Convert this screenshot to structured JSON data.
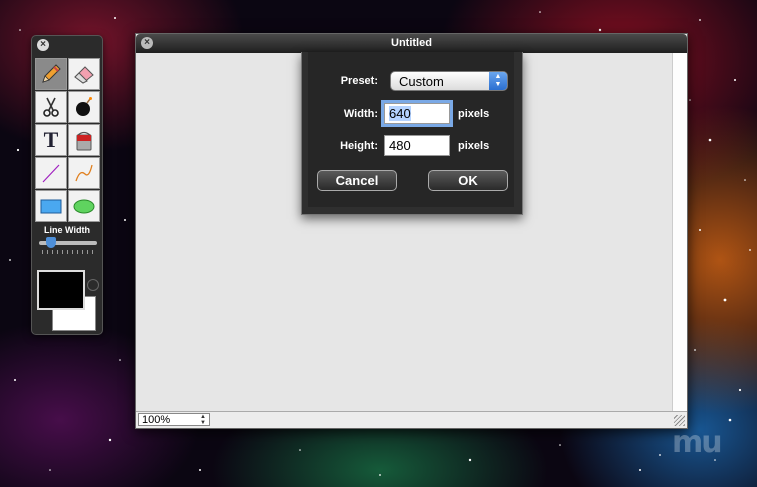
{
  "palette": {
    "line_width_label": "Line Width",
    "line_width_value": 0.2,
    "foreground_color": "#000000",
    "background_color": "#ffffff",
    "tools": [
      {
        "name": "pencil",
        "icon": "pencil-icon",
        "active": true
      },
      {
        "name": "eraser",
        "icon": "eraser-icon"
      },
      {
        "name": "scissors",
        "icon": "scissors-icon"
      },
      {
        "name": "bomb",
        "icon": "bomb-icon"
      },
      {
        "name": "text",
        "icon": "text-tool-icon",
        "glyph": "T"
      },
      {
        "name": "paint-bucket",
        "icon": "paint-bucket-icon"
      },
      {
        "name": "line",
        "icon": "line-tool-icon"
      },
      {
        "name": "curve",
        "icon": "curve-tool-icon"
      },
      {
        "name": "rectangle",
        "icon": "rectangle-tool-icon"
      },
      {
        "name": "ellipse",
        "icon": "ellipse-tool-icon"
      }
    ]
  },
  "window": {
    "title": "Untitled",
    "zoom": "100%"
  },
  "dialog": {
    "preset_label": "Preset:",
    "preset_value": "Custom",
    "width_label": "Width:",
    "width_value": "640",
    "height_label": "Height:",
    "height_value": "480",
    "unit": "pixels",
    "cancel_label": "Cancel",
    "ok_label": "OK"
  },
  "colors": {
    "accent": "#2b6fd1",
    "focus_ring": "#7aa9e6"
  }
}
